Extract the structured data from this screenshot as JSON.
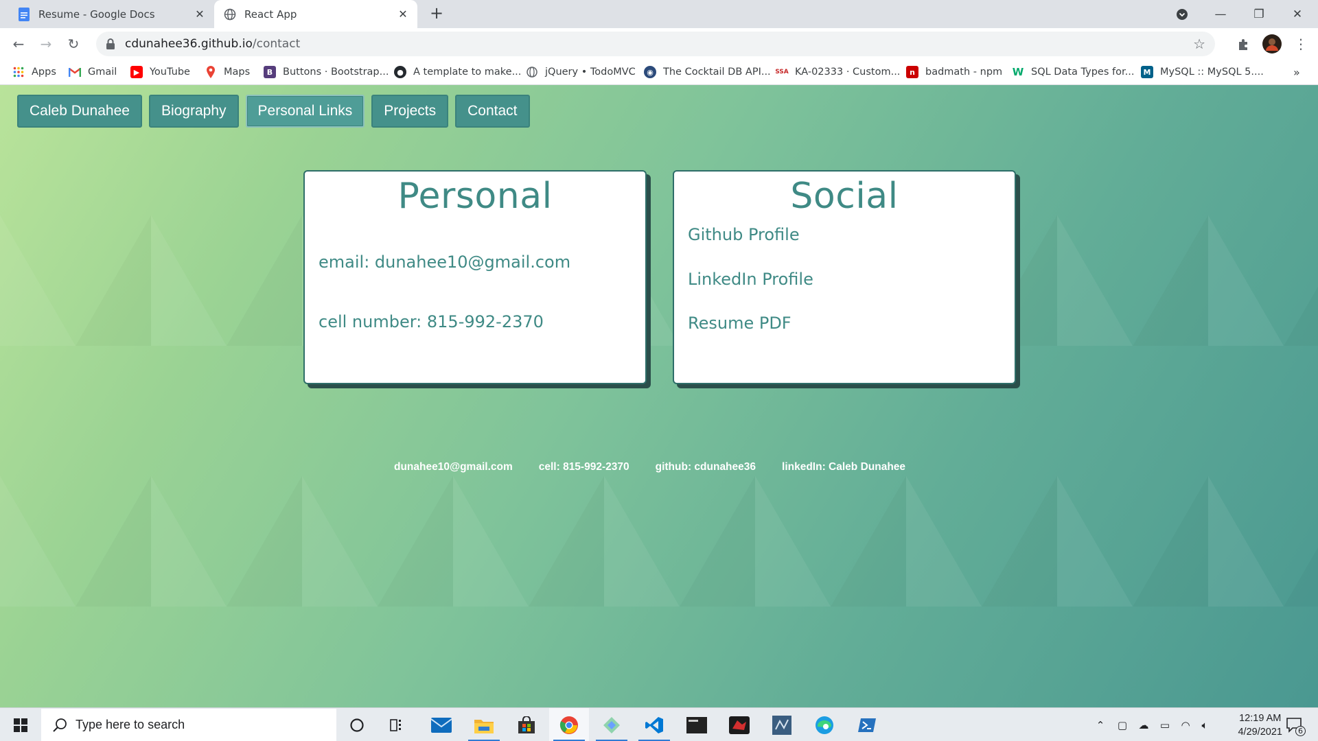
{
  "browser": {
    "tabs": [
      {
        "title": "Resume - Google Docs",
        "icon": "google-docs-icon",
        "active": false
      },
      {
        "title": "React App",
        "icon": "globe-icon",
        "active": true
      }
    ],
    "url_host": "cdunahee36.github.io",
    "url_path": "/contact",
    "bookmarks": [
      {
        "label": "Apps",
        "icon": "apps-grid-icon"
      },
      {
        "label": "Gmail",
        "icon": "gmail-icon"
      },
      {
        "label": "YouTube",
        "icon": "youtube-icon"
      },
      {
        "label": "Maps",
        "icon": "maps-icon"
      },
      {
        "label": "Buttons · Bootstrap...",
        "icon": "bootstrap-icon"
      },
      {
        "label": "A template to make...",
        "icon": "github-icon"
      },
      {
        "label": "jQuery • TodoMVC",
        "icon": "globe-icon"
      },
      {
        "label": "The Cocktail DB API...",
        "icon": "cocktail-icon"
      },
      {
        "label": "KA-02333 · Custom...",
        "icon": "ssa-icon"
      },
      {
        "label": "badmath - npm",
        "icon": "npm-icon"
      },
      {
        "label": "SQL Data Types for...",
        "icon": "w3schools-icon"
      },
      {
        "label": "MySQL :: MySQL 5....",
        "icon": "mysql-icon"
      }
    ],
    "bookmark_overflow": "»"
  },
  "page": {
    "nav": [
      "Caleb Dunahee",
      "Biography",
      "Personal Links",
      "Projects",
      "Contact"
    ],
    "personal": {
      "title": "Personal",
      "email": "email: dunahee10@gmail.com",
      "cell": "cell number: 815-992-2370"
    },
    "social": {
      "title": "Social",
      "links": [
        "Github Profile",
        "LinkedIn Profile",
        "Resume PDF"
      ]
    },
    "footer": [
      "dunahee10@gmail.com",
      "cell: 815-992-2370",
      "github: cdunahee36",
      "linkedIn: Caleb Dunahee"
    ],
    "colors": {
      "accent": "#45918b",
      "card_text": "#3f8a85"
    }
  },
  "taskbar": {
    "search_placeholder": "Type here to search",
    "time": "12:19 AM",
    "date": "4/29/2021",
    "notification_count": "6"
  }
}
